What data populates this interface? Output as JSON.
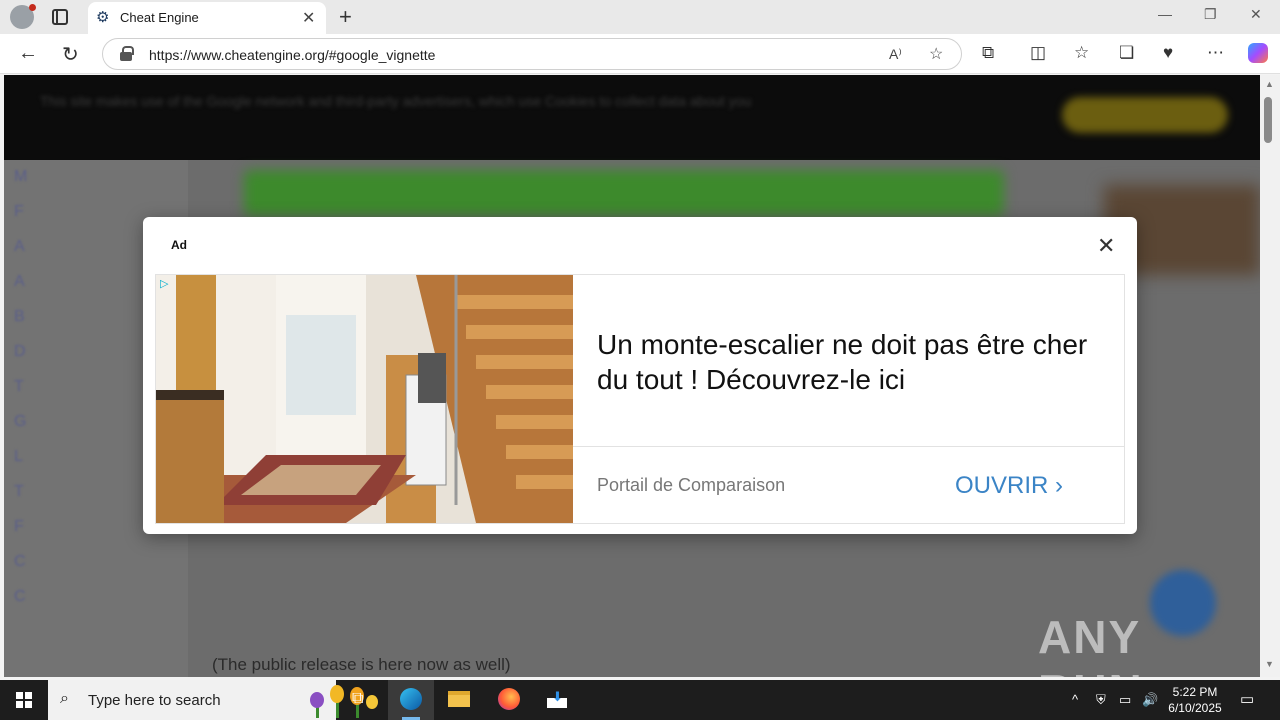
{
  "browser": {
    "tab_title": "Cheat Engine",
    "url": "https://www.cheatengine.org/#google_vignette",
    "read_aloud_icon": "A⁾"
  },
  "page": {
    "cookie_notice": "This site makes use of the Google network and third-party advertisers, which use Cookies to collect data about you",
    "sidebar_initials": [
      "M",
      "F",
      "A",
      "A",
      "B",
      "D",
      "T",
      "G",
      "L",
      "T",
      "F",
      "C",
      "C"
    ],
    "public_release_text": "(The public release is here now as well)",
    "watermark": "ANY RUN"
  },
  "ad": {
    "label": "Ad",
    "headline": "Un monte-escalier ne doit pas être cher du tout ! Découvrez-le ici",
    "advertiser": "Portail de Comparaison",
    "cta": "OUVRIR"
  },
  "taskbar": {
    "search_placeholder": "Type here to search",
    "time": "5:22 PM",
    "date": "6/10/2025"
  }
}
